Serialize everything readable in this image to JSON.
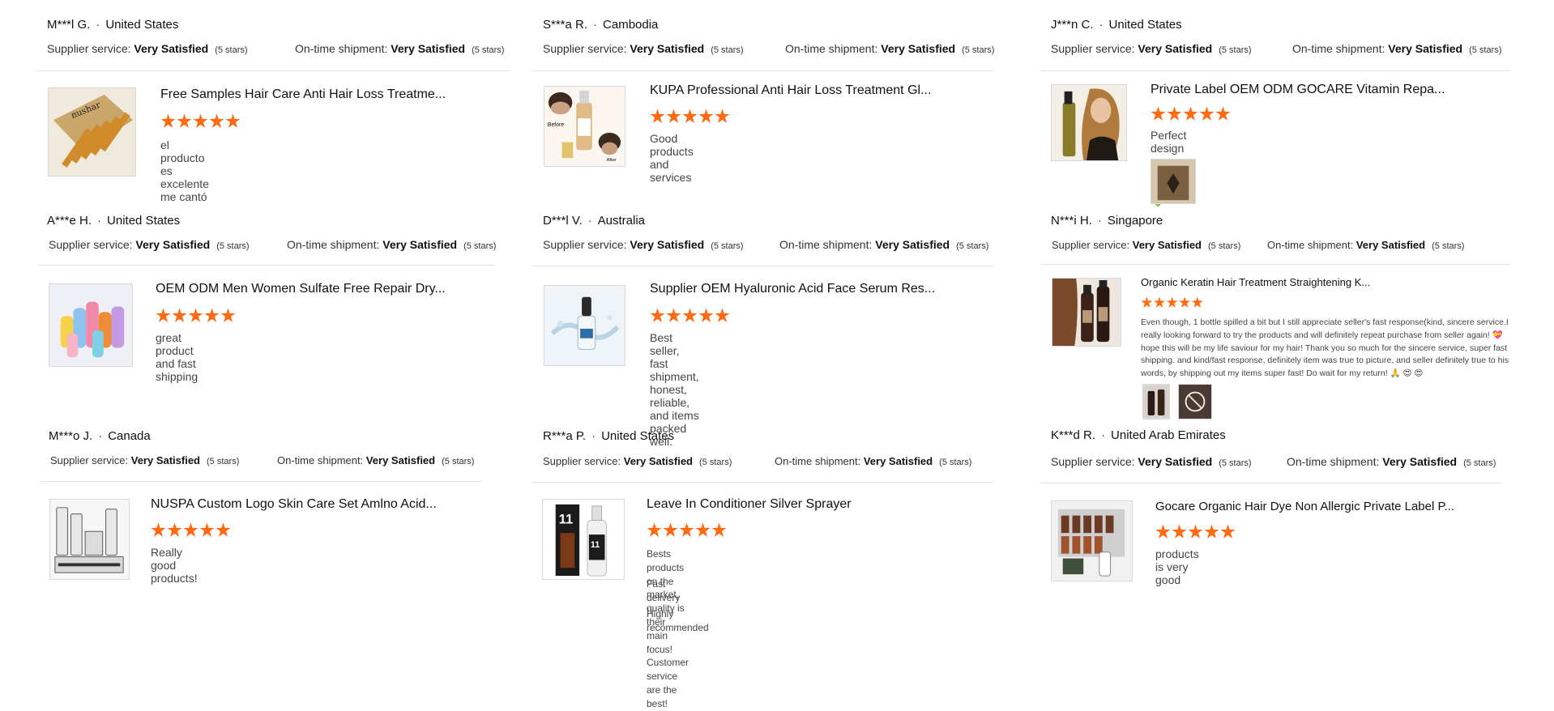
{
  "reviews": [
    {
      "name": "M***l G.",
      "country": "United States",
      "supplier_label": "Supplier service:",
      "supplier_value": "Very Satisfied",
      "supplier_stars": "(5 stars)",
      "shipment_label": "On-time shipment:",
      "shipment_value": "Very Satisfied",
      "shipment_stars": "(5 stars)",
      "product_title": "Free Samples Hair Care Anti Hair Loss Treatme...",
      "rating": 5,
      "comment": "el producto es excelente me cantó",
      "image_icon": "ampoule-box-image"
    },
    {
      "name": "S***a R.",
      "country": "Cambodia",
      "supplier_label": "Supplier service:",
      "supplier_value": "Very Satisfied",
      "supplier_stars": "(5 stars)",
      "shipment_label": "On-time shipment:",
      "shipment_value": "Very Satisfied",
      "shipment_stars": "(5 stars)",
      "product_title": "KUPA Professional Anti Hair Loss Treatment Gl...",
      "rating": 5,
      "comment": "Good products and services",
      "image_icon": "hair-serum-before-after-image",
      "image_text": {
        "before": "Before",
        "after": "After"
      }
    },
    {
      "name": "J***n C.",
      "country": "United States",
      "supplier_label": "Supplier service:",
      "supplier_value": "Very Satisfied",
      "supplier_stars": "(5 stars)",
      "shipment_label": "On-time shipment:",
      "shipment_value": "Very Satisfied",
      "shipment_stars": "(5 stars)",
      "product_title": "Private Label OEM ODM GOCARE Vitamin Repa...",
      "rating": 5,
      "comment": "Perfect design spray, perfect quality 🌷",
      "image_icon": "spray-model-image",
      "photos": [
        "package-photo"
      ]
    },
    {
      "name": "A***e H.",
      "country": "United States",
      "supplier_label": "Supplier service:",
      "supplier_value": "Very Satisfied",
      "supplier_stars": "(5 stars)",
      "shipment_label": "On-time shipment:",
      "shipment_value": "Very Satisfied",
      "shipment_stars": "(5 stars)",
      "product_title": "OEM ODM Men Women Sulfate Free Repair Dry...",
      "rating": 5,
      "comment": "great product and fast shipping",
      "image_icon": "colorful-bottles-image"
    },
    {
      "name": "D***l V.",
      "country": "Australia",
      "supplier_label": "Supplier service:",
      "supplier_value": "Very Satisfied",
      "supplier_stars": "(5 stars)",
      "shipment_label": "On-time shipment:",
      "shipment_value": "Very Satisfied",
      "shipment_stars": "(5 stars)",
      "product_title": "Supplier OEM Hyaluronic Acid Face Serum Res...",
      "rating": 5,
      "comment": "Best seller, fast shipment, honest, reliable, and items packed well.",
      "image_icon": "serum-dropper-image"
    },
    {
      "name": "N***i H.",
      "country": "Singapore",
      "supplier_label": "Supplier service:",
      "supplier_value": "Very Satisfied",
      "supplier_stars": "(5 stars)",
      "shipment_label": "On-time shipment:",
      "shipment_value": "Very Satisfied",
      "shipment_stars": "(5 stars)",
      "product_title": "Organic Keratin Hair Treatment Straightening K...",
      "rating": 5,
      "comment": "Even though, 1 bottle spilled a bit but I still appreciate seller's fast response(kind, sincere service.I really looking forward to try the products and will definitely repeat purchase from seller again! 💝 hope this will be my life saviour for my hair! Thank you so much for the sincere service, super fast shipping. and kind/fast response, definitely item was true to picture, and seller definitely true to his words, by shipping out my items super fast! Do wait for my return! 🙏 😍 😍",
      "image_icon": "keratin-bottles-image",
      "photos": [
        "bottles-photo",
        "box-photo"
      ]
    },
    {
      "name": "M***o J.",
      "country": "Canada",
      "supplier_label": "Supplier service:",
      "supplier_value": "Very Satisfied",
      "supplier_stars": "(5 stars)",
      "shipment_label": "On-time shipment:",
      "shipment_value": "Very Satisfied",
      "shipment_stars": "(5 stars)",
      "product_title": "NUSPA Custom Logo Skin Care Set Amlno Acid...",
      "rating": 5,
      "comment": "Really good products!",
      "image_icon": "skincare-set-image"
    },
    {
      "name": "R***a P.",
      "country": "United States",
      "supplier_label": "Supplier service:",
      "supplier_value": "Very Satisfied",
      "supplier_stars": "(5 stars)",
      "shipment_label": "On-time shipment:",
      "shipment_value": "Very Satisfied",
      "shipment_stars": "(5 stars)",
      "product_title": "Leave In Conditioner Silver Sprayer",
      "rating": 5,
      "comment": "Bests products on the market, quality is their main focus! Customer service are the best!",
      "comment_2": "Fast delivery !",
      "comment_3": "Highly recommended",
      "image_icon": "spray-bottle-11-image",
      "image_text": {
        "badge": "11"
      }
    },
    {
      "name": "K***d R.",
      "country": "United Arab Emirates",
      "supplier_label": "Supplier service:",
      "supplier_value": "Very Satisfied",
      "supplier_stars": "(5 stars)",
      "shipment_label": "On-time shipment:",
      "shipment_value": "Very Satisfied",
      "shipment_stars": "(5 stars)",
      "product_title": "Gocare Organic Hair Dye Non Allergic Private Label P...",
      "rating": 5,
      "comment": "products is very good",
      "image_icon": "hair-dye-display-image"
    }
  ],
  "colors": {
    "star": "#ff6a13",
    "divider": "#e3e3e3",
    "border": "#d9d9d9"
  }
}
